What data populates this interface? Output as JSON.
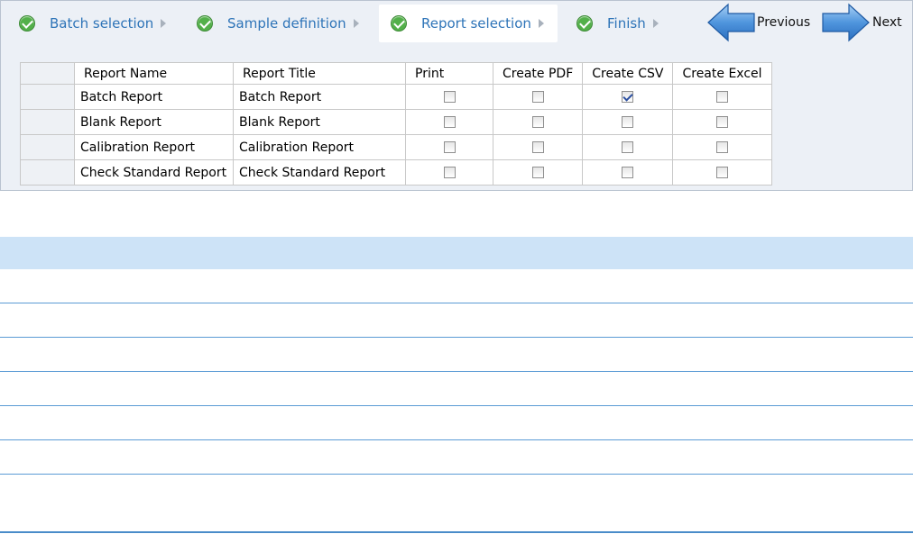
{
  "wizard": {
    "steps": [
      {
        "label": "Batch selection",
        "icon": "check-icon",
        "active": false
      },
      {
        "label": "Sample definition",
        "icon": "check-icon",
        "active": false
      },
      {
        "label": "Report selection",
        "icon": "check-icon",
        "active": true
      },
      {
        "label": "Finish",
        "icon": "check-icon",
        "active": false
      }
    ],
    "previous_label": "Previous",
    "next_label": "Next"
  },
  "grid": {
    "columns": [
      "Report Name",
      "Report Title",
      "Print",
      "Create PDF",
      "Create CSV",
      "Create Excel"
    ],
    "rows": [
      {
        "name": "Batch Report",
        "title": "Batch Report",
        "print": false,
        "pdf": false,
        "csv": true,
        "excel": false
      },
      {
        "name": "Blank Report",
        "title": "Blank Report",
        "print": false,
        "pdf": false,
        "csv": false,
        "excel": false
      },
      {
        "name": "Calibration Report",
        "title": "Calibration Report",
        "print": false,
        "pdf": false,
        "csv": false,
        "excel": false
      },
      {
        "name": "Check Standard Report",
        "title": "Check Standard Report",
        "print": false,
        "pdf": false,
        "csv": false,
        "excel": false
      }
    ]
  },
  "colors": {
    "accent_text": "#2e74b8",
    "header_band": "#cde3f7",
    "row_line": "#5b9bd5",
    "check_green": "#53b04a"
  }
}
